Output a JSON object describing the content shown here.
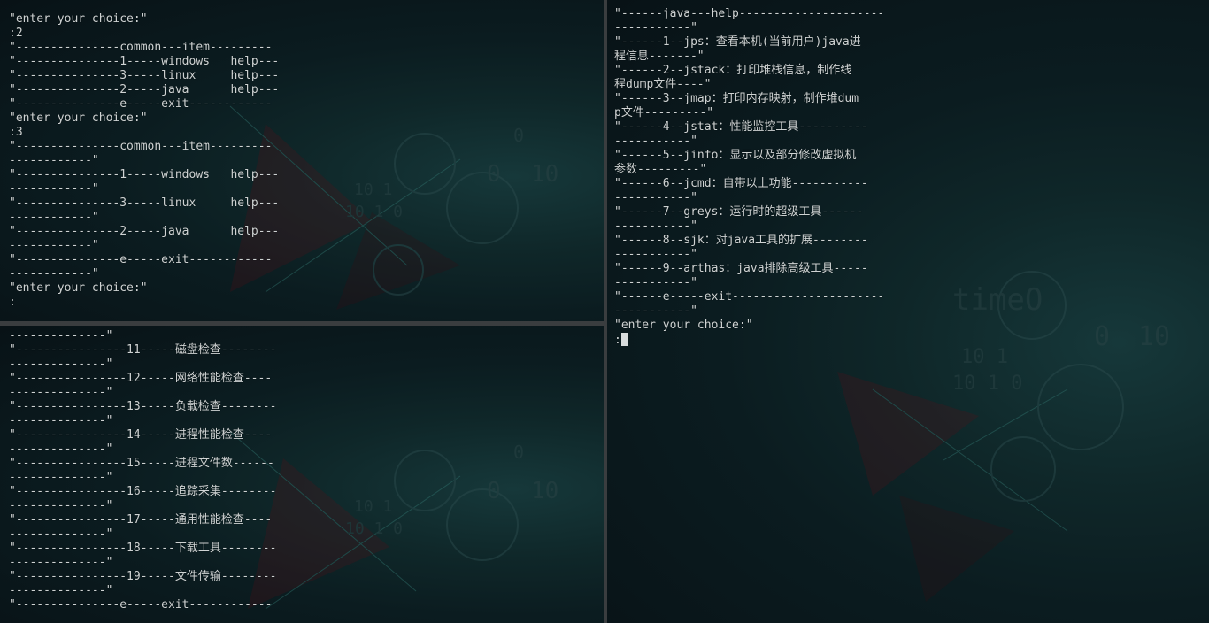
{
  "panes": {
    "top_left": {
      "lines": [
        "\"enter your choice:\"",
        ":2",
        "\"---------------common---item---------",
        "\"---------------1-----windows   help---",
        "\"---------------3-----linux     help---",
        "\"---------------2-----java      help---",
        "\"---------------e-----exit------------",
        "\"enter your choice:\"",
        ":3",
        "\"---------------common---item---------",
        "------------\"",
        "\"---------------1-----windows   help---",
        "------------\"",
        "\"---------------3-----linux     help---",
        "------------\"",
        "\"---------------2-----java      help---",
        "------------\"",
        "\"---------------e-----exit------------",
        "------------\"",
        "\"enter your choice:\"",
        ":"
      ]
    },
    "bottom_left": {
      "lines": [
        "--------------\"",
        "\"----------------11-----磁盘检查--------",
        "--------------\"",
        "\"----------------12-----网络性能检查----",
        "--------------\"",
        "\"----------------13-----负载检查--------",
        "--------------\"",
        "\"----------------14-----进程性能检查----",
        "--------------\"",
        "\"----------------15-----进程文件数------",
        "--------------\"",
        "\"----------------16-----追踪采集--------",
        "--------------\"",
        "\"----------------17-----通用性能检查----",
        "--------------\"",
        "\"----------------18-----下载工具--------",
        "--------------\"",
        "\"----------------19-----文件传输--------",
        "--------------\"",
        "\"---------------e-----exit------------"
      ]
    },
    "right": {
      "lines": [
        "\"------java---help---------------------",
        "-----------\"",
        "\"------1--jps：查看本机(当前用户)java进",
        "程信息-------\"",
        "\"------2--jstack：打印堆栈信息，制作线",
        "程dump文件----\"",
        "\"------3--jmap：打印内存映射，制作堆dum",
        "p文件---------\"",
        "\"------4--jstat：性能监控工具----------",
        "-----------\"",
        "\"------5--jinfo：显示以及部分修改虚拟机",
        "参数---------\"",
        "\"------6--jcmd：自带以上功能-----------",
        "-----------\"",
        "\"------7--greys：运行时的超级工具------",
        "-----------\"",
        "\"------8--sjk：对java工具的扩展--------",
        "-----------\"",
        "\"------9--arthas：java排除高级工具-----",
        "-----------\"",
        "\"------e-----exit----------------------",
        "-----------\"",
        "\"enter your choice:\""
      ],
      "prompt": ":"
    }
  },
  "colors": {
    "text": "#cfd3d3",
    "background": "#0b1c20",
    "divider": "#3a3d3f",
    "accent_red": "#7a1620"
  }
}
